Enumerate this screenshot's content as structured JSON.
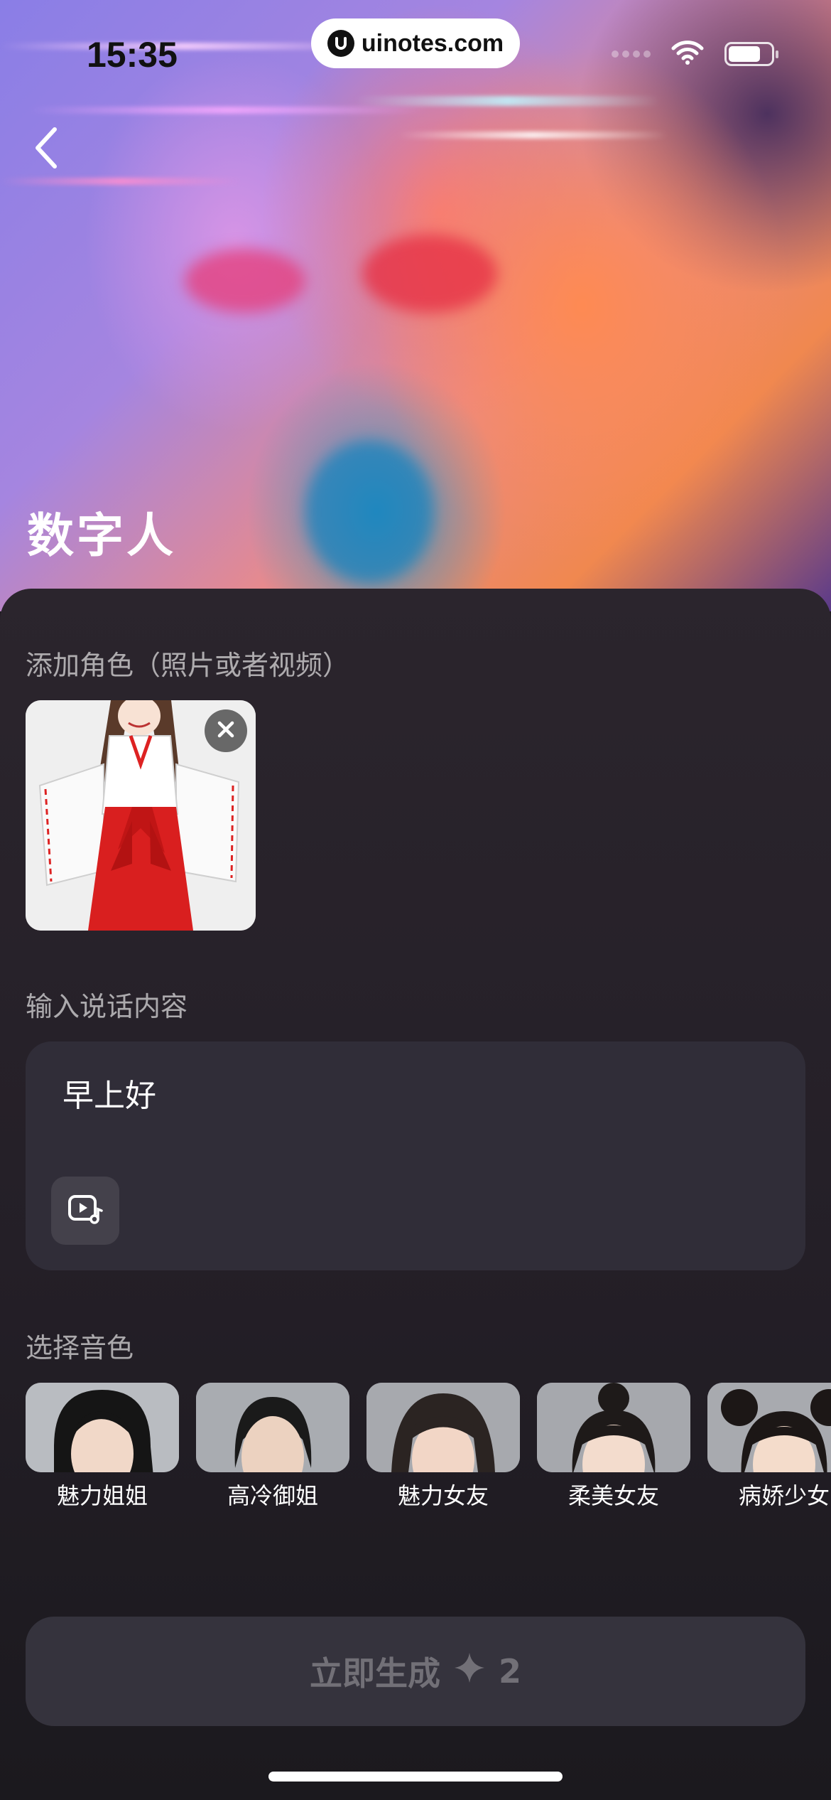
{
  "status_bar": {
    "time": "15:35",
    "url": "uinotes.com",
    "battery_level": 0.75
  },
  "header": {
    "title": "数字人"
  },
  "role_section": {
    "label": "添加角色（照片或者视频）"
  },
  "speech_section": {
    "label": "输入说话内容",
    "text": "早上好"
  },
  "voice_section": {
    "label": "选择音色",
    "voices": [
      {
        "name": "魅力姐姐"
      },
      {
        "name": "高冷御姐"
      },
      {
        "name": "魅力女友"
      },
      {
        "name": "柔美女友"
      },
      {
        "name": "病娇少女"
      }
    ]
  },
  "generate": {
    "label": "立即生成",
    "cost": "2"
  },
  "colors": {
    "sheet_background": "#2b252d",
    "input_background": "#302d38",
    "button_background": "#35333d"
  }
}
